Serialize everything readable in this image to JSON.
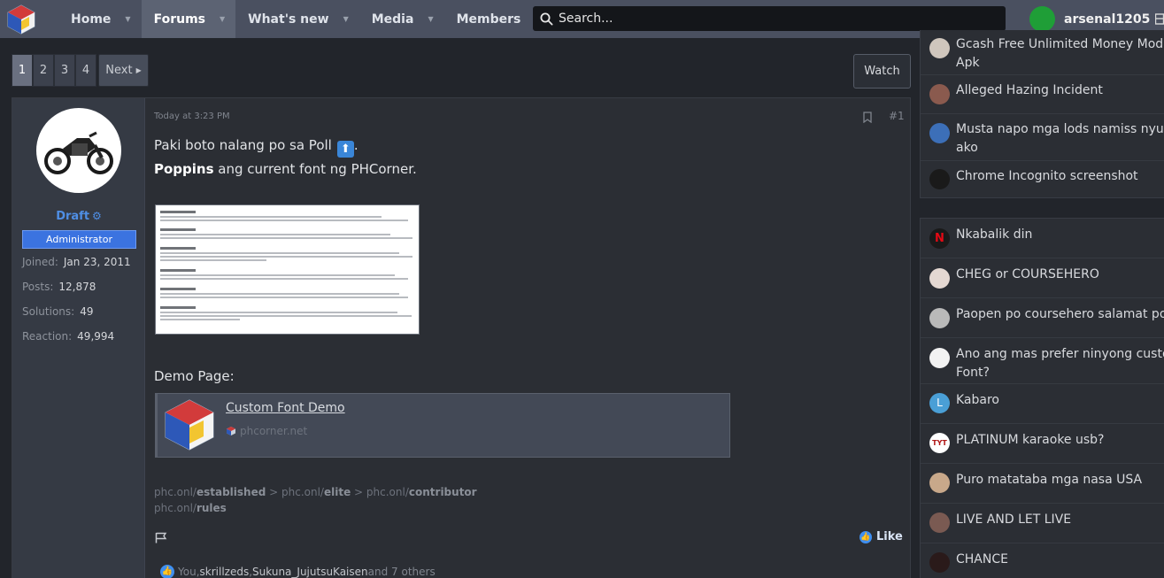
{
  "nav": {
    "tabs": [
      {
        "label": "Home"
      },
      {
        "label": "Forums"
      },
      {
        "label": "What's new"
      },
      {
        "label": "Media"
      },
      {
        "label": "Members"
      }
    ],
    "search_placeholder": "Search...",
    "username": "arsenal1205"
  },
  "pager": {
    "pages": [
      "1",
      "2",
      "3",
      "4"
    ],
    "next_label": "Next"
  },
  "watch_label": "Watch",
  "post": {
    "author": {
      "name": "Draft",
      "banner": "Administrator",
      "stats": [
        {
          "label": "Joined:",
          "value": "Jan 23, 2011"
        },
        {
          "label": "Posts:",
          "value": "12,878"
        },
        {
          "label": "Solutions:",
          "value": "49"
        },
        {
          "label": "Reaction:",
          "value": "49,994"
        }
      ]
    },
    "timestamp": "Today at 3:23 PM",
    "number": "#1",
    "line1": "Paki boto nalang po sa Poll",
    "line2_bold": "Poppins",
    "line2_rest": " ang current font ng PHCorner.",
    "demo_label": "Demo Page:",
    "link_card": {
      "title": "Custom Font Demo",
      "domain": "phcorner.net"
    },
    "signature": {
      "p1": "phc.onl/",
      "b1": "established",
      "sep1": " > phc.onl/",
      "b2": "elite",
      "sep2": " > phc.onl/",
      "b3": "contributor",
      "p2": "phc.onl/",
      "b4": "rules"
    },
    "like_label": "Like",
    "reactions": {
      "you": "You",
      "comma1": ", ",
      "user1": "skrillzeds",
      "comma2": ", ",
      "user2": "Sukuna_JujutsuKaisen",
      "rest": " and 7 others"
    }
  },
  "sidebar": {
    "block1": [
      {
        "title1": "Gcash Free Unlimited Money Mod",
        "title2": "Apk"
      },
      {
        "title1": "Alleged Hazing Incident",
        "title2": ""
      },
      {
        "title1": "Musta napo mga lods namiss nyu ba",
        "title2": "ako"
      },
      {
        "title1": "Chrome Incognito screenshot",
        "title2": ""
      }
    ],
    "block2": [
      {
        "title1": "Nkabalik din",
        "title2": "",
        "avatar_letter": "N"
      },
      {
        "title1": "CHEG or COURSEHERO",
        "title2": "",
        "avatar_letter": ""
      },
      {
        "title1": "Paopen po coursehero salamat po",
        "title2": "",
        "avatar_letter": ""
      },
      {
        "title1": "Ano ang mas prefer ninyong custom",
        "title2": "Font?",
        "avatar_letter": ""
      },
      {
        "title1": "Kabaro",
        "title2": "",
        "avatar_letter": "L"
      },
      {
        "title1": "PLATINUM karaoke usb?",
        "title2": "",
        "avatar_letter": "TYT"
      },
      {
        "title1": "Puro matataba mga nasa USA",
        "title2": "",
        "avatar_letter": ""
      },
      {
        "title1": "LIVE AND LET LIVE",
        "title2": "",
        "avatar_letter": ""
      },
      {
        "title1": "CHANCE",
        "title2": "",
        "avatar_letter": ""
      }
    ]
  },
  "colors": {
    "nav_bg": "#4a5060",
    "page_bg": "#22252b",
    "accent_blue": "#3b73e0",
    "user_avatar": "#1f9e37"
  }
}
